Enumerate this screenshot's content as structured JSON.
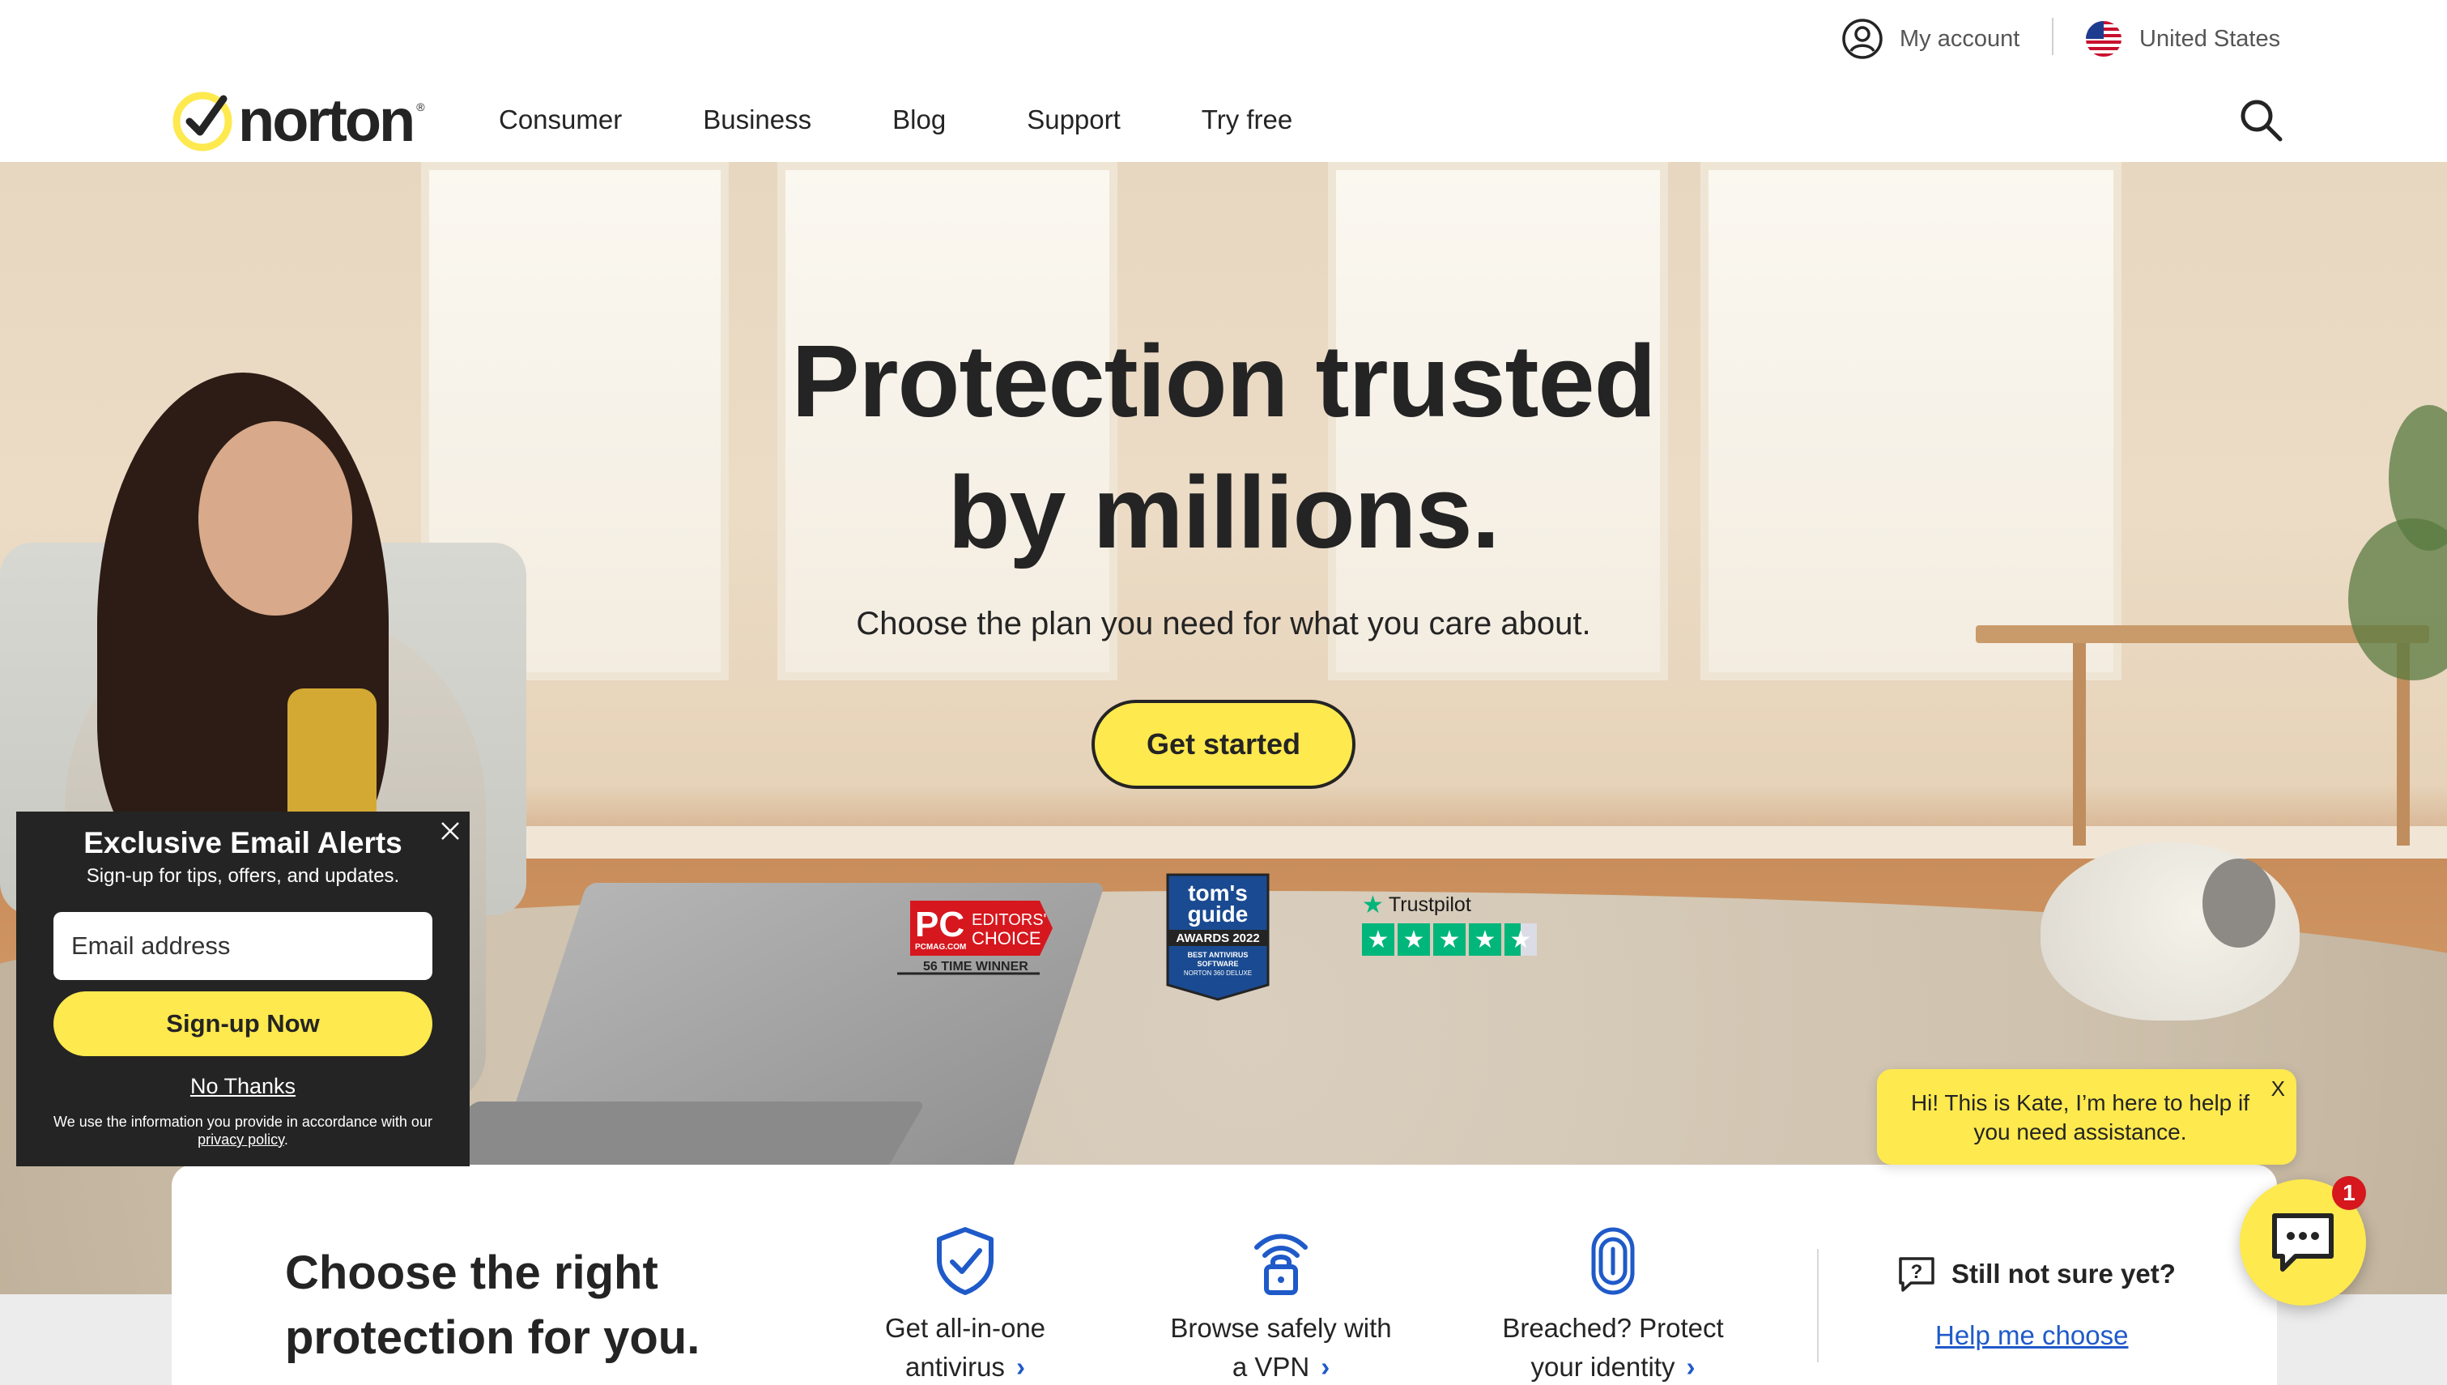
{
  "utility": {
    "account_label": "My account",
    "country_label": "United States"
  },
  "nav": {
    "logo_text": "norton",
    "logo_tm": "®",
    "links": [
      "Consumer",
      "Business",
      "Blog",
      "Support",
      "Try free"
    ],
    "search_icon": "search-icon"
  },
  "hero": {
    "title_line1": "Protection trusted",
    "title_line2": "by millions.",
    "subtitle": "Choose the plan you need for what you care about.",
    "cta_label": "Get started"
  },
  "awards": {
    "pc_main": "PC",
    "pc_editors": "EDITORS'",
    "pc_choice": "CHOICE",
    "pc_site": "PCMAG.COM",
    "pc_winner": "56 TIME WINNER",
    "toms_line1": "tom's",
    "toms_line2": "guide",
    "toms_awards": "AWARDS 2022",
    "toms_best": "BEST ANTIVIRUS",
    "toms_software": "SOFTWARE",
    "toms_product": "NORTON 360 DELUXE",
    "trustpilot_label": "Trustpilot",
    "trustpilot_rating": 4.5
  },
  "email_popup": {
    "title": "Exclusive Email Alerts",
    "subtitle": "Sign-up for tips, offers, and updates.",
    "email_placeholder": "Email address",
    "signup_label": "Sign-up Now",
    "no_thanks_label": "No Thanks",
    "legal_text": "We use the information you provide in accordance with our ",
    "privacy_link": "privacy policy",
    "legal_end": "."
  },
  "chat": {
    "message": "Hi! This is Kate, I’m here to help if you need assistance.",
    "close_label": "X",
    "badge_count": "1"
  },
  "choose": {
    "title_line1": "Choose the right",
    "title_line2": "protection for you.",
    "features": [
      {
        "line1": "Get all-in-one",
        "line2": "antivirus",
        "icon": "shield-check-icon"
      },
      {
        "line1": "Browse safely with",
        "line2": "a VPN",
        "icon": "wifi-lock-icon"
      },
      {
        "line1": "Breached? Protect",
        "line2": "your identity",
        "icon": "fingerprint-icon"
      }
    ],
    "not_sure_label": "Still not sure yet?",
    "help_link": "Help me choose"
  },
  "colors": {
    "brand_yellow": "#fee94e",
    "text_dark": "#242424",
    "link_blue": "#1f5ac9",
    "popup_bg": "#242424",
    "trustpilot_green": "#00b67a"
  }
}
